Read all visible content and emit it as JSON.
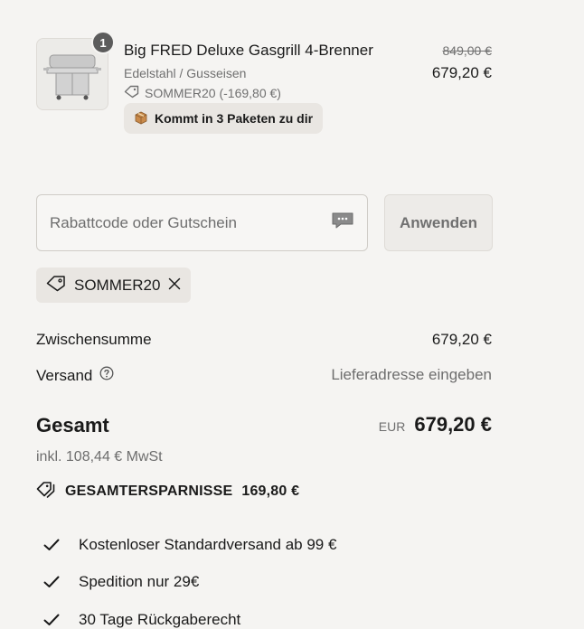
{
  "line_item": {
    "quantity": "1",
    "title": "Big FRED Deluxe Gasgrill 4-Brenner",
    "variant": "Edelstahl / Gusseisen",
    "discount_note": "SOMMER20 (-169,80 €)",
    "shipping_pill": "Kommt in 3 Paketen zu dir",
    "price_original": "849,00 €",
    "price_current": "679,20 €",
    "thumbnail_icon": "gas-grill-image"
  },
  "discount_form": {
    "placeholder": "Rabattcode oder Gutschein",
    "apply_label": "Anwenden"
  },
  "applied_code": {
    "code": "SOMMER20"
  },
  "summary": {
    "subtotal_label": "Zwischensumme",
    "subtotal_value": "679,20 €",
    "shipping_label": "Versand",
    "shipping_value": "Lieferadresse eingeben",
    "total_label": "Gesamt",
    "total_currency": "EUR",
    "total_value": "679,20 €",
    "tax_note": "inkl. 108,44 € MwSt",
    "savings_label": "GESAMTERSPARNISSE",
    "savings_value": "169,80 €"
  },
  "benefits": [
    "Kostenloser Standardversand ab 99 €",
    "Spedition nur 29€",
    "30 Tage Rückgaberecht"
  ],
  "colors": {
    "background": "#f5f4f2",
    "pill": "#e9e6e2",
    "muted_text": "#6e6e6e"
  }
}
